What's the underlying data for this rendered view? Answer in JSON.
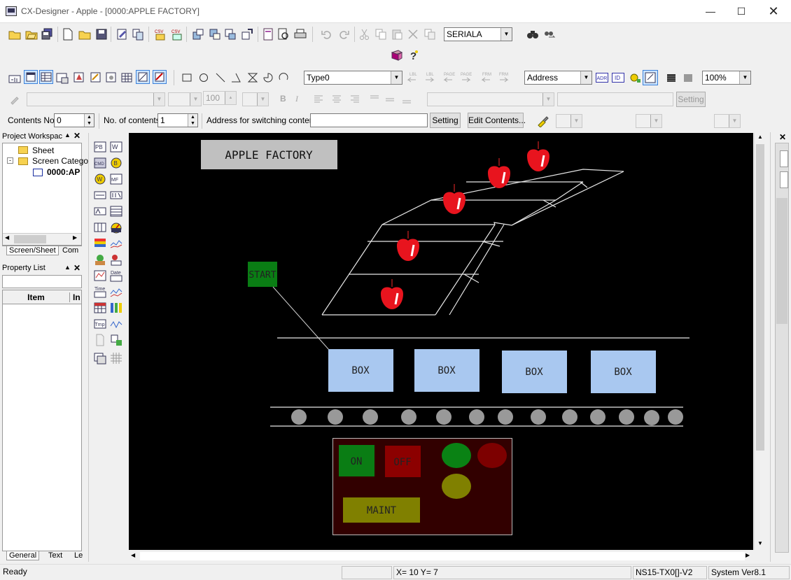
{
  "window": {
    "title": "CX-Designer - Apple - [0000:APPLE FACTORY]"
  },
  "toolbar1": {
    "serial_combo": "SERIALA"
  },
  "toolbar2": {
    "type_combo": "Type0",
    "address_combo": "Address",
    "zoom_combo": "100%",
    "adr_icon": "ADR",
    "id_icon": "ID",
    "font_size": "100",
    "setting_label": "Setting"
  },
  "contentsbar": {
    "contents_no_label": "Contents No.",
    "contents_no_value": "0",
    "no_of_contents_label": "No. of contents",
    "no_of_contents_value": "1",
    "address_label": "Address for switching contents",
    "address_value": "",
    "setting_button": "Setting",
    "edit_button": "Edit Contents..."
  },
  "workspace": {
    "title": "Project Workspac",
    "tree": [
      "Sheet",
      "Screen Catego",
      "0000:AP"
    ],
    "tabs": [
      "Screen/Sheet",
      "Com"
    ]
  },
  "property_list": {
    "title": "Property List",
    "col_item": "Item",
    "col_in": "In",
    "tabs": [
      "General",
      "Text",
      "Le"
    ]
  },
  "palette": {
    "pb": "PB",
    "w": "W",
    "cmd": "CMD",
    "b": "B",
    "mf": "MF",
    "date": "Date",
    "time": "Time",
    "tmp": "Tmp"
  },
  "screen": {
    "title": "APPLE FACTORY",
    "start": "START",
    "boxes": [
      "BOX",
      "BOX",
      "BOX",
      "BOX"
    ],
    "on": "ON",
    "off": "OFF",
    "maint": "MAINT"
  },
  "status": {
    "ready": "Ready",
    "coords": "X=  10 Y=   7",
    "model": "NS15-TX0[]-V2",
    "version": "System Ver8.1"
  },
  "colors": {
    "canvas": "#000000",
    "box": "#a9c8f0",
    "apple": "#e8141e",
    "start": "#0a7d14",
    "panel": "#320000",
    "maint": "#808000"
  }
}
